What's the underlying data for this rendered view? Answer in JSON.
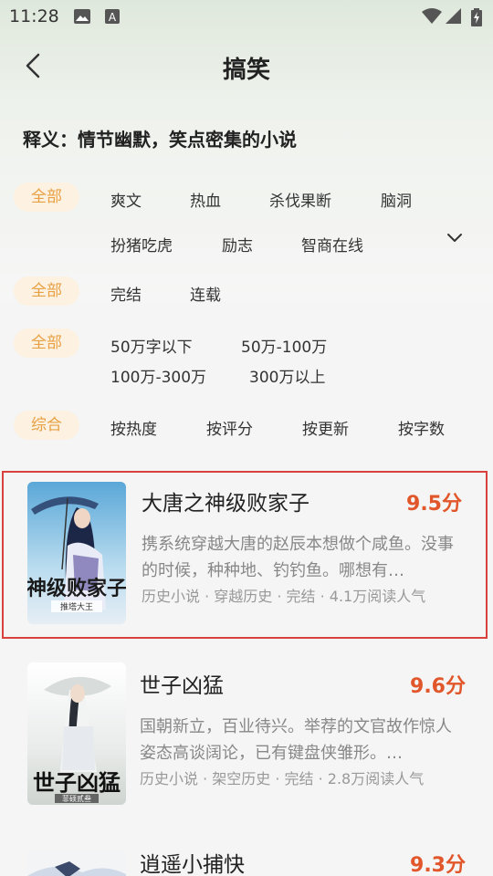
{
  "status": {
    "time": "11:28"
  },
  "header": {
    "title": "搞笑"
  },
  "definition": {
    "text": "释义：情节幽默，笑点密集的小说"
  },
  "filters": {
    "genre": {
      "all": "全部",
      "options": [
        "爽文",
        "热血",
        "杀伐果断",
        "脑洞",
        "扮猪吃虎",
        "励志",
        "智商在线"
      ]
    },
    "status": {
      "all": "全部",
      "options": [
        "完结",
        "连载"
      ]
    },
    "length": {
      "all": "全部",
      "options": [
        "50万字以下",
        "50万-100万",
        "100万-300万",
        "300万以上"
      ]
    },
    "sort": {
      "all": "综合",
      "options": [
        "按热度",
        "按评分",
        "按更新",
        "按字数"
      ]
    }
  },
  "books": [
    {
      "title": "大唐之神级败家子",
      "score": "9.5分",
      "desc": "携系统穿越大唐的赵辰本想做个咸鱼。没事的时候，种种地、钓钓鱼。哪想有…",
      "meta": "历史小说 · 穿越历史 · 完结 · 4.1万阅读人气",
      "cover_text": "大唐之神级败家子",
      "cover_author": "推塔大王"
    },
    {
      "title": "世子凶猛",
      "score": "9.6分",
      "desc": "国朝新立，百业待兴。举荐的文官故作惊人姿态高谈阔论，已有键盘侠雏形。…",
      "meta": "历史小说 · 架空历史 · 完结 · 2.8万阅读人气",
      "cover_text": "世子凶猛",
      "cover_author": "菲硕贰叁"
    },
    {
      "title": "逍遥小捕快",
      "score": "9.3分"
    }
  ],
  "colors": {
    "accent": "#e8a042",
    "chip_bg": "#fdf1e1",
    "score": "#e2562b",
    "highlight": "#d9413f"
  }
}
